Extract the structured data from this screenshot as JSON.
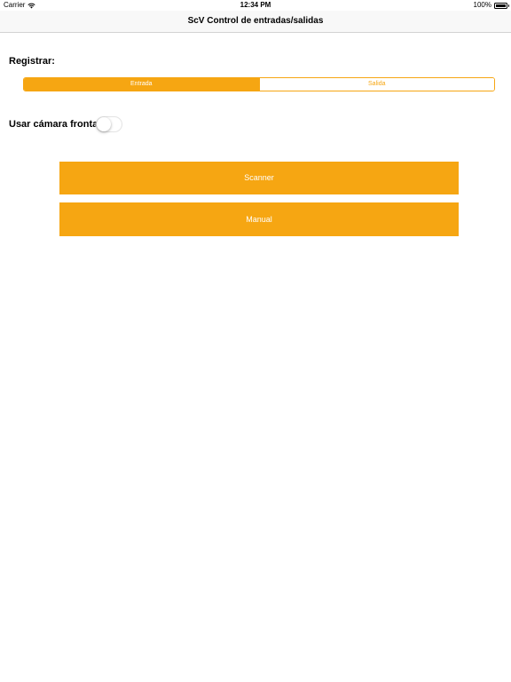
{
  "status_bar": {
    "carrier": "Carrier",
    "time": "12:34 PM",
    "battery": "100%",
    "battery_level": 1.0
  },
  "nav": {
    "title": "ScV Control de entradas/salidas"
  },
  "form": {
    "registrar_label": "Registrar:",
    "segments": [
      {
        "label": "Entrada",
        "selected": true
      },
      {
        "label": "Salida",
        "selected": false
      }
    ],
    "camera_label": "Usar cámara frontal:",
    "camera_toggle_on": false
  },
  "buttons": {
    "scanner": "Scanner",
    "manual": "Manual"
  },
  "colors": {
    "accent": "#f6a612",
    "nav_background": "#f8f8f8",
    "background": "#ffffff"
  },
  "icons": {
    "wifi": "wifi-icon",
    "battery": "battery-icon"
  }
}
